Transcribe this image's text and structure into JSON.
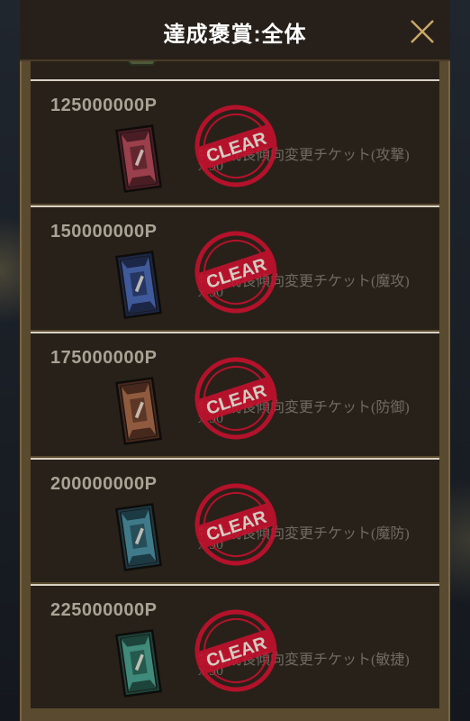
{
  "header": {
    "title": "達成褒賞:全体",
    "close_icon": "close-x-icon"
  },
  "stamp_text": "CLEAR",
  "rewards": [
    {
      "points": "125000000P",
      "name": "特殊成長傾向変更チケット(攻撃)",
      "qty": "x 50",
      "color": "#9a3f4b",
      "dark": "#4a1c24"
    },
    {
      "points": "150000000P",
      "name": "特殊成長傾向変更チケット(魔攻)",
      "qty": "x 50",
      "color": "#3f5a9a",
      "dark": "#1c2748"
    },
    {
      "points": "175000000P",
      "name": "特殊成長傾向変更チケット(防御)",
      "qty": "x 50",
      "color": "#8f5a3e",
      "dark": "#47281c"
    },
    {
      "points": "200000000P",
      "name": "特殊成長傾向変更チケット(魔防)",
      "qty": "x 50",
      "color": "#3f7a8a",
      "dark": "#1c3a44"
    },
    {
      "points": "225000000P",
      "name": "特殊成長傾向変更チケット(敏捷)",
      "qty": "x 50",
      "color": "#3f8a7a",
      "dark": "#1c443a"
    }
  ]
}
